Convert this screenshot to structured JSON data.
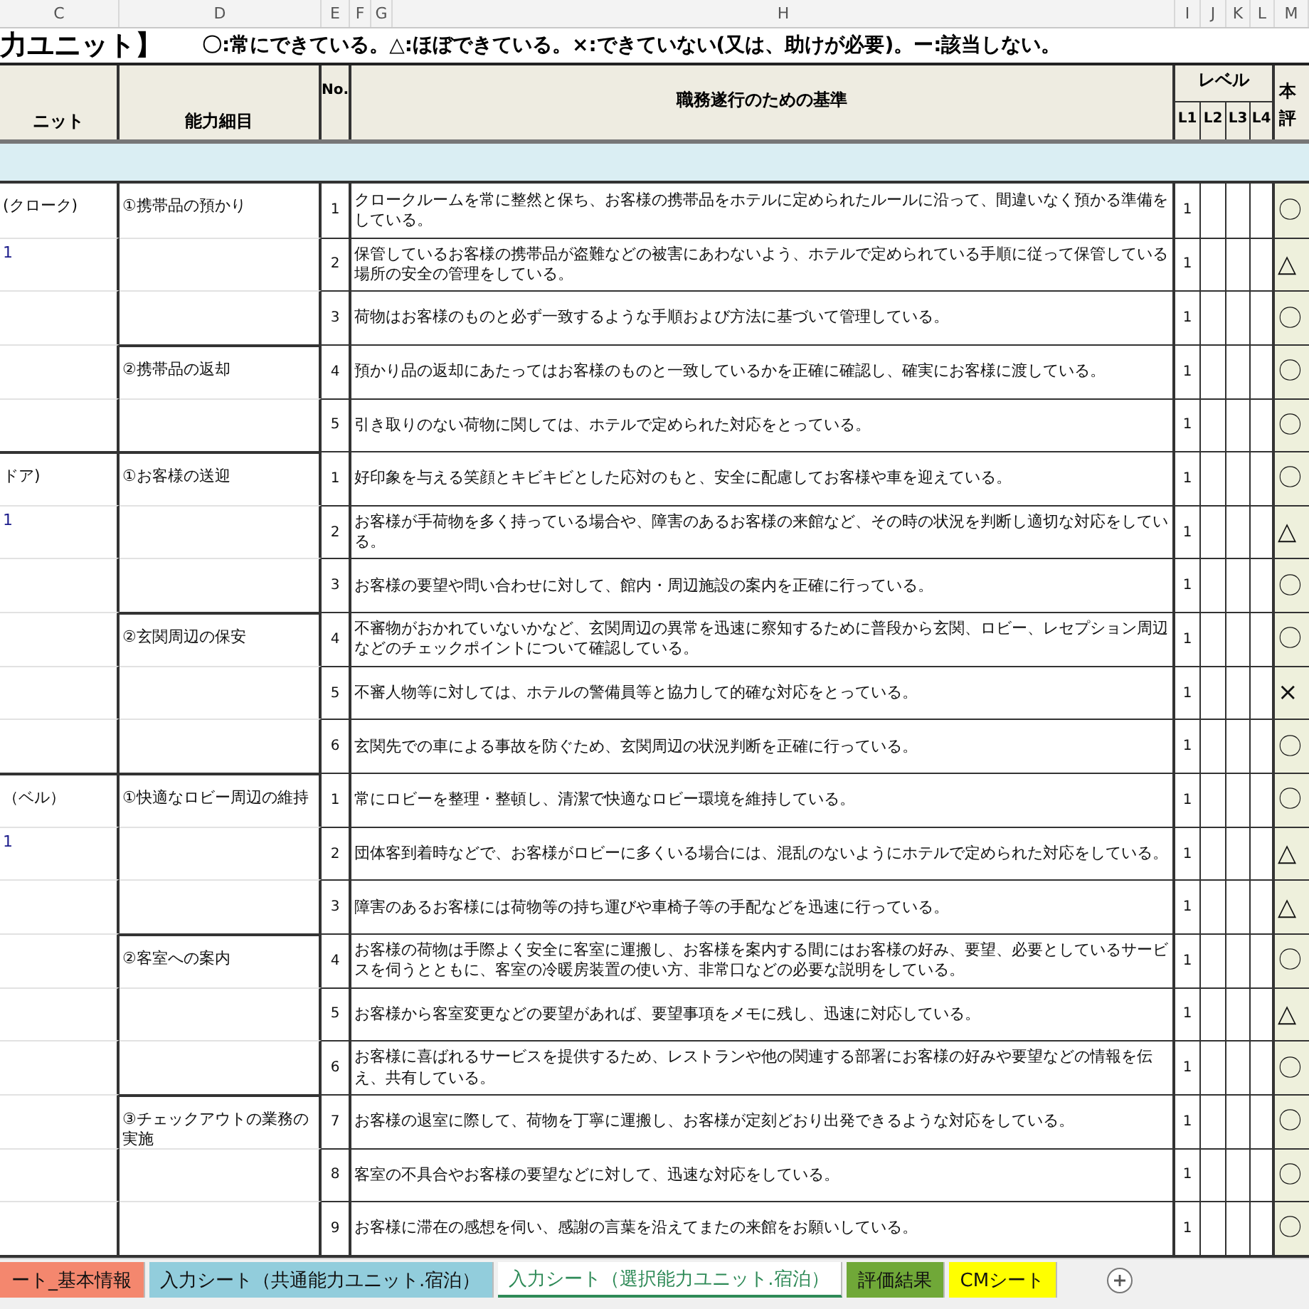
{
  "column_letters": [
    "C",
    "D",
    "E",
    "F",
    "G",
    "H",
    "I",
    "J",
    "K",
    "L",
    "M"
  ],
  "title": "力ユニット】",
  "legend": "〇:常にできている。△:ほぼできている。×:できていない(又は、助けが必要)。ー:該当しない。",
  "header": {
    "unit": "ニット",
    "detail": "能力細目",
    "no": "No.",
    "criterion": "職務遂行のための基準",
    "level": "レベル",
    "levels": [
      "L1",
      "L2",
      "L3",
      "L4"
    ],
    "evaluation": [
      "本",
      "評"
    ]
  },
  "units": [
    {
      "label": "(クローク)",
      "code": "1",
      "details": [
        {
          "label": "①携帯品の預かり",
          "items": [
            {
              "no": "1",
              "text": "クロークルームを常に整然と保ち、お客様の携帯品をホテルに定められたルールに沿って、間違いなく預かる準備をしている。",
              "l1": "1",
              "mark": "〇"
            },
            {
              "no": "2",
              "text": "保管しているお客様の携帯品が盗難などの被害にあわないよう、ホテルで定められている手順に従って保管している場所の安全の管理をしている。",
              "l1": "1",
              "mark": "△"
            },
            {
              "no": "3",
              "text": "荷物はお客様のものと必ず一致するような手順および方法に基づいて管理している。",
              "l1": "1",
              "mark": "〇"
            }
          ]
        },
        {
          "label": "②携帯品の返却",
          "items": [
            {
              "no": "4",
              "text": "預かり品の返却にあたってはお客様のものと一致しているかを正確に確認し、確実にお客様に渡している。",
              "l1": "1",
              "mark": "〇"
            },
            {
              "no": "5",
              "text": "引き取りのない荷物に関しては、ホテルで定められた対応をとっている。",
              "l1": "1",
              "mark": "〇"
            }
          ]
        }
      ]
    },
    {
      "label": "ドア)",
      "code": "1",
      "details": [
        {
          "label": "①お客様の送迎",
          "items": [
            {
              "no": "1",
              "text": "好印象を与える笑顔とキビキビとした応対のもと、安全に配慮してお客様や車を迎えている。",
              "l1": "1",
              "mark": "〇"
            },
            {
              "no": "2",
              "text": "お客様が手荷物を多く持っている場合や、障害のあるお客様の来館など、その時の状況を判断し適切な対応をしている。",
              "l1": "1",
              "mark": "△"
            },
            {
              "no": "3",
              "text": "お客様の要望や問い合わせに対して、館内・周辺施設の案内を正確に行っている。",
              "l1": "1",
              "mark": "〇"
            }
          ]
        },
        {
          "label": "②玄関周辺の保安",
          "items": [
            {
              "no": "4",
              "text": "不審物がおかれていないかなど、玄関周辺の異常を迅速に察知するために普段から玄関、ロビー、レセプション周辺などのチェックポイントについて確認している。",
              "l1": "1",
              "mark": "〇"
            },
            {
              "no": "5",
              "text": "不審人物等に対しては、ホテルの警備員等と協力して的確な対応をとっている。",
              "l1": "1",
              "mark": "×"
            },
            {
              "no": "6",
              "text": "玄関先での車による事故を防ぐため、玄関周辺の状況判断を正確に行っている。",
              "l1": "1",
              "mark": "〇"
            }
          ]
        }
      ]
    },
    {
      "label": "（ベル）",
      "code": "1",
      "details": [
        {
          "label": "①快適なロビー周辺の維持",
          "items": [
            {
              "no": "1",
              "text": "常にロビーを整理・整頓し、清潔で快適なロビー環境を維持している。",
              "l1": "1",
              "mark": "〇"
            },
            {
              "no": "2",
              "text": "団体客到着時などで、お客様がロビーに多くいる場合には、混乱のないようにホテルで定められた対応をしている。",
              "l1": "1",
              "mark": "△"
            },
            {
              "no": "3",
              "text": "障害のあるお客様には荷物等の持ち運びや車椅子等の手配などを迅速に行っている。",
              "l1": "1",
              "mark": "△"
            }
          ]
        },
        {
          "label": "②客室への案内",
          "items": [
            {
              "no": "4",
              "text": "お客様の荷物は手際よく安全に客室に運搬し、お客様を案内する間にはお客様の好み、要望、必要としているサービスを伺うとともに、客室の冷暖房装置の使い方、非常口などの必要な説明をしている。",
              "l1": "1",
              "mark": "〇"
            },
            {
              "no": "5",
              "text": "お客様から客室変更などの要望があれば、要望事項をメモに残し、迅速に対応している。",
              "l1": "1",
              "mark": "△"
            },
            {
              "no": "6",
              "text": "お客様に喜ばれるサービスを提供するため、レストランや他の関連する部署にお客様の好みや要望などの情報を伝え、共有している。",
              "l1": "1",
              "mark": "〇"
            }
          ]
        },
        {
          "label": "③チェックアウトの業務の実施",
          "items": [
            {
              "no": "7",
              "text": "お客様の退室に際して、荷物を丁寧に運搬し、お客様が定刻どおり出発できるような対応をしている。",
              "l1": "1",
              "mark": "〇"
            },
            {
              "no": "8",
              "text": "客室の不具合やお客様の要望などに対して、迅速な対応をしている。",
              "l1": "1",
              "mark": "〇"
            },
            {
              "no": "9",
              "text": "お客様に滞在の感想を伺い、感謝の言葉を沿えてまたの来館をお願いしている。",
              "l1": "1",
              "mark": "〇"
            }
          ]
        }
      ]
    }
  ],
  "sheet_tabs": [
    {
      "label": "ート_基本情報",
      "color": "#f4876e",
      "selected": false
    },
    {
      "label": "入力シート（共通能力ユニット.宿泊）",
      "color": "#92cddc",
      "selected": false
    },
    {
      "label": "入力シート（選択能力ユニット.宿泊）",
      "color": "#ffffff",
      "selected": true
    },
    {
      "label": "評価結果",
      "color": "#70a838",
      "selected": false
    },
    {
      "label": "CMシート",
      "color": "#ffff00",
      "selected": false
    }
  ]
}
